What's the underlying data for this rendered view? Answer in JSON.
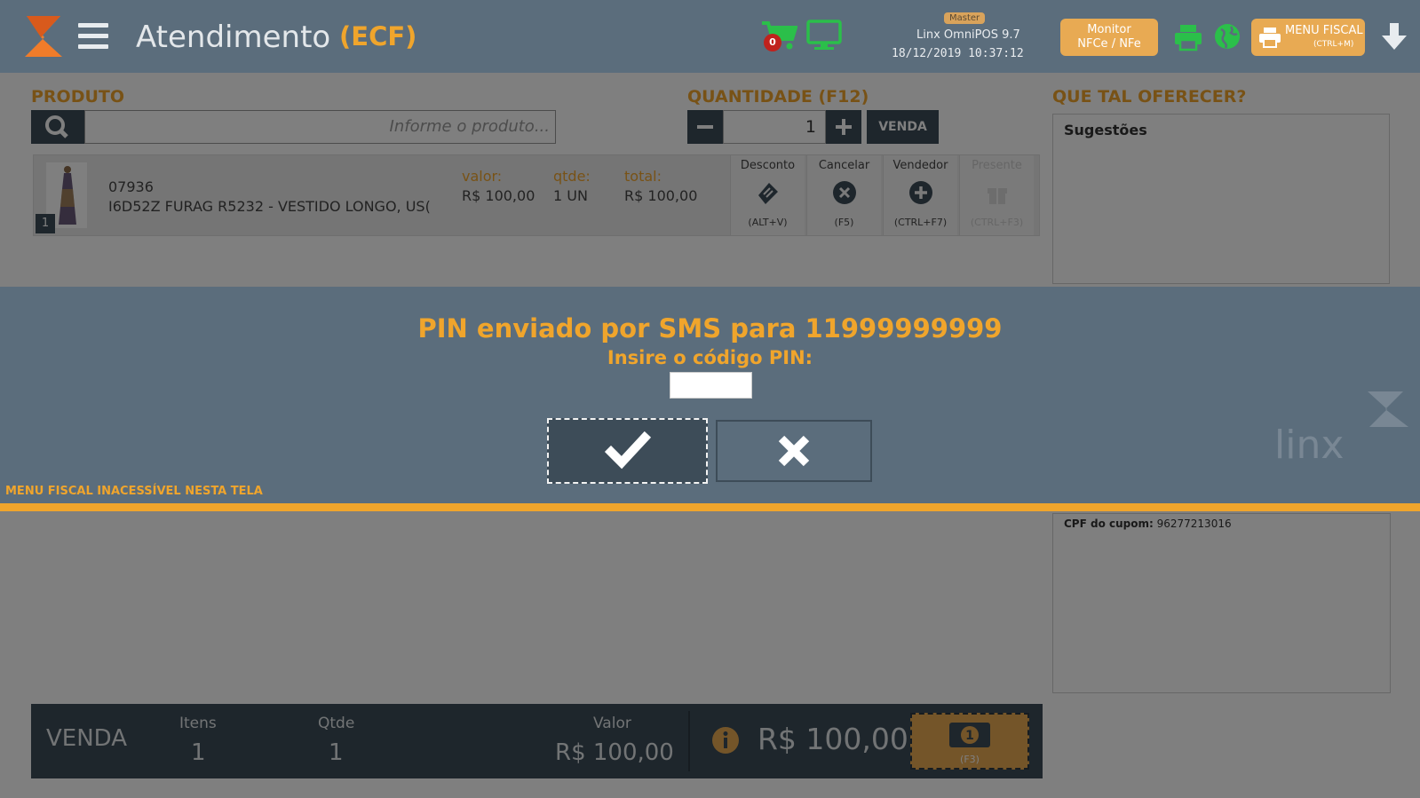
{
  "header": {
    "title": "Atendimento",
    "mode": "(ECF)",
    "cart_count": "0",
    "user_badge": "Master",
    "pos_name": "Linx OmniPOS  9.7",
    "pos_datetime": "18/12/2019 10:37:12",
    "monitor_btn": {
      "line1": "Monitor",
      "line2": "NFCe / NFe"
    },
    "menu_fiscal_btn": {
      "label": "MENU FISCAL",
      "shortcut": "(CTRL+M)"
    }
  },
  "product": {
    "section_label": "PRODUTO",
    "search_placeholder": "Informe o produto..."
  },
  "quantity": {
    "section_label": "QUANTIDADE (F12)",
    "value": "1",
    "venda_label": "VENDA"
  },
  "suggestions": {
    "section_label": "QUE TAL OFERECER?",
    "title": "Sugestões"
  },
  "items": [
    {
      "index": "1",
      "code": "07936",
      "description": "I6D52Z FURAG R5232 - VESTIDO LONGO, US(",
      "valor_label": "valor:",
      "valor": "R$ 100,00",
      "qtde_label": "qtde:",
      "qtde": "1 UN",
      "total_label": "total:",
      "total": "R$ 100,00",
      "actions": [
        {
          "label": "Desconto",
          "key": "(ALT+V)",
          "icon": "ticket-icon"
        },
        {
          "label": "Cancelar",
          "key": "(F5)",
          "icon": "close-circle-icon"
        },
        {
          "label": "Vendedor",
          "key": "(CTRL+F7)",
          "icon": "plus-circle-icon"
        },
        {
          "label": "Presente",
          "key": "(CTRL+F3)",
          "icon": "gift-icon"
        }
      ]
    }
  ],
  "cpf": {
    "label": "CPF do cupom:",
    "value": "96277213016"
  },
  "footer": {
    "venda": "VENDA",
    "itens_label": "Itens",
    "itens": "1",
    "qtde_label": "Qtde",
    "qtde": "1",
    "valor_label": "Valor",
    "valor": "R$ 100,00",
    "total": "R$ 100,00",
    "pay_key": "(F3)"
  },
  "dialog": {
    "title": "PIN enviado por SMS para 11999999999",
    "subtitle": "Insire o código PIN:",
    "pin_value": "",
    "note": "MENU FISCAL INACESSÍVEL NESTA TELA",
    "watermark_text": "linx"
  },
  "colors": {
    "header_bg": "#5b6d7c",
    "dark": "#3d4c58",
    "accent": "#f0a52c",
    "green": "#2bbf4a"
  }
}
